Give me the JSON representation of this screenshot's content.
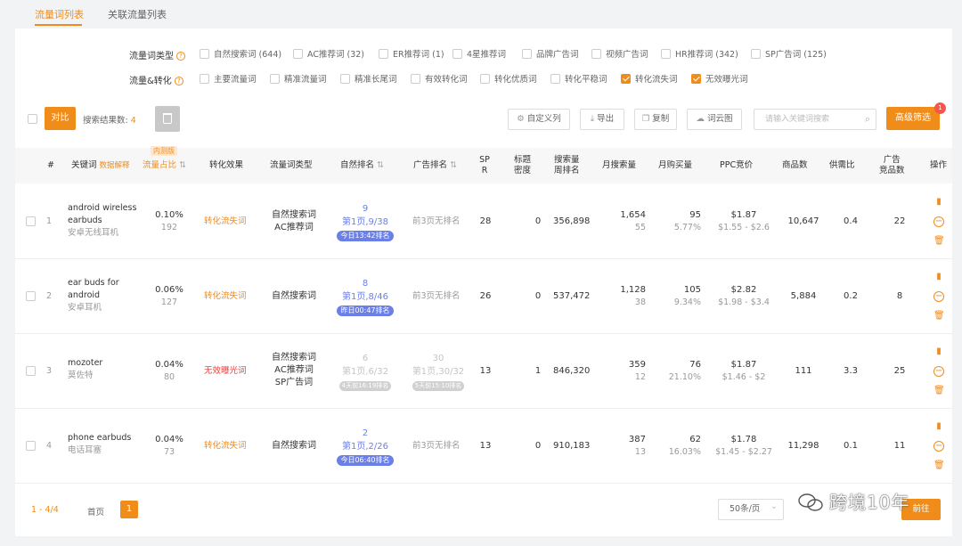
{
  "tabs": [
    {
      "label": "流量词列表",
      "active": true
    },
    {
      "label": "关联流量列表",
      "active": false
    }
  ],
  "filters": {
    "type_label": "流量词类型",
    "type_options": [
      {
        "label": "自然搜索词 (644)",
        "checked": false
      },
      {
        "label": "AC推荐词 (32)",
        "checked": false
      },
      {
        "label": "ER推荐词 (1)",
        "checked": false
      },
      {
        "label": "4星推荐词",
        "checked": false
      },
      {
        "label": "品牌广告词",
        "checked": false
      },
      {
        "label": "视频广告词",
        "checked": false
      },
      {
        "label": "HR推荐词 (342)",
        "checked": false
      },
      {
        "label": "SP广告词 (125)",
        "checked": false
      }
    ],
    "conv_label": "流量&转化",
    "conv_options": [
      {
        "label": "主要流量词",
        "checked": false
      },
      {
        "label": "精准流量词",
        "checked": false
      },
      {
        "label": "精准长尾词",
        "checked": false
      },
      {
        "label": "有效转化词",
        "checked": false
      },
      {
        "label": "转化优质词",
        "checked": false
      },
      {
        "label": "转化平稳词",
        "checked": false
      },
      {
        "label": "转化流失词",
        "checked": true
      },
      {
        "label": "无效曝光词",
        "checked": true
      }
    ]
  },
  "toolbar": {
    "compare": "对比",
    "results_label": "搜索结果数:",
    "results_count": "4",
    "custom_cols": "自定义列",
    "export": "导出",
    "copy": "复制",
    "cloud": "词云图",
    "search_placeholder": "请输入关键词搜索",
    "advanced": "高级筛选",
    "advanced_badge": "1"
  },
  "headers": {
    "idx": "#",
    "keyword": "关键词",
    "data_explain": "数据解释",
    "hot": "内测版",
    "traffic_share": "流量占比",
    "conversion": "转化效果",
    "kw_type": "流量词类型",
    "natural_rank": "自然排名",
    "ad_rank": "广告排名",
    "spr_1": "SP",
    "spr_2": "R",
    "title_1": "标题",
    "title_2": "密度",
    "search_rank_1": "搜索量",
    "search_rank_2": "周排名",
    "monthly_search": "月搜索量",
    "monthly_buy": "月购买量",
    "ppc": "PPC竞价",
    "products": "商品数",
    "supply_demand": "供需比",
    "ad_products_1": "广告",
    "ad_products_2": "竞品数",
    "ops": "操作"
  },
  "rows": [
    {
      "idx": "1",
      "kw_en_1": "android wireless",
      "kw_en_2": "earbuds",
      "kw_cn": "安卓无线耳机",
      "share": "0.10%",
      "share_sub": "192",
      "conv": "转化流失词",
      "conv_type": "orange",
      "types": [
        "自然搜索词",
        "AC推荐词"
      ],
      "rank_main": "9",
      "rank_page": "第1页,9/38",
      "rank_pill": "今日13:42排名",
      "ad": "前3页无排名",
      "spr": "28",
      "title": "0",
      "search_rank": "356,898",
      "msearch": "1,654",
      "msearch_sub": "55",
      "mbuy": "95",
      "mbuy_sub": "5.77%",
      "ppc": "$1.87",
      "ppc_range": "$1.55 - $2.6",
      "products": "10,647",
      "sd": "0.4",
      "adp": "22"
    },
    {
      "idx": "2",
      "kw_en_1": "ear buds for",
      "kw_en_2": "android",
      "kw_cn": "安卓耳机",
      "share": "0.06%",
      "share_sub": "127",
      "conv": "转化流失词",
      "conv_type": "orange",
      "types": [
        "自然搜索词"
      ],
      "rank_main": "8",
      "rank_page": "第1页,8/46",
      "rank_pill": "昨日00:47排名",
      "ad": "前3页无排名",
      "spr": "26",
      "title": "0",
      "search_rank": "537,472",
      "msearch": "1,128",
      "msearch_sub": "38",
      "mbuy": "105",
      "mbuy_sub": "9.34%",
      "ppc": "$2.82",
      "ppc_range": "$1.98 - $3.4",
      "products": "5,884",
      "sd": "0.2",
      "adp": "8"
    },
    {
      "idx": "3",
      "kw_en_1": "mozoter",
      "kw_en_2": "",
      "kw_cn": "莫佐特",
      "share": "0.04%",
      "share_sub": "80",
      "conv": "无效曝光词",
      "conv_type": "red",
      "types": [
        "自然搜索词",
        "AC推荐词",
        "SP广告词"
      ],
      "rank_main": "6",
      "rank_page": "第1页,6/32",
      "rank_pill": "4天前16:19排名",
      "ad_main": "30",
      "ad_page": "第1页,30/32",
      "ad_pill": "5天前15:10排名",
      "spr": "13",
      "title": "1",
      "search_rank": "846,320",
      "msearch": "359",
      "msearch_sub": "12",
      "mbuy": "76",
      "mbuy_sub": "21.10%",
      "ppc": "$1.87",
      "ppc_range": "$1.46 - $2",
      "products": "111",
      "sd": "3.3",
      "adp": "25"
    },
    {
      "idx": "4",
      "kw_en_1": "phone earbuds",
      "kw_en_2": "",
      "kw_cn": "电话耳塞",
      "share": "0.04%",
      "share_sub": "73",
      "conv": "转化流失词",
      "conv_type": "orange",
      "types": [
        "自然搜索词"
      ],
      "rank_main": "2",
      "rank_page": "第1页,2/26",
      "rank_pill": "今日06:40排名",
      "ad": "前3页无排名",
      "spr": "13",
      "title": "0",
      "search_rank": "910,183",
      "msearch": "387",
      "msearch_sub": "13",
      "mbuy": "62",
      "mbuy_sub": "16.03%",
      "ppc": "$1.78",
      "ppc_range": "$1.45 - $2.27",
      "products": "11,298",
      "sd": "0.1",
      "adp": "11"
    }
  ],
  "footer": {
    "range": "1 - 4/4",
    "first": "首页",
    "page": "1",
    "size": "50条/页",
    "goto": "前往"
  },
  "watermark": "跨境10年",
  "colors": {
    "accent": "#f08c1a",
    "blue": "#6b80e6",
    "red": "#e84040"
  }
}
